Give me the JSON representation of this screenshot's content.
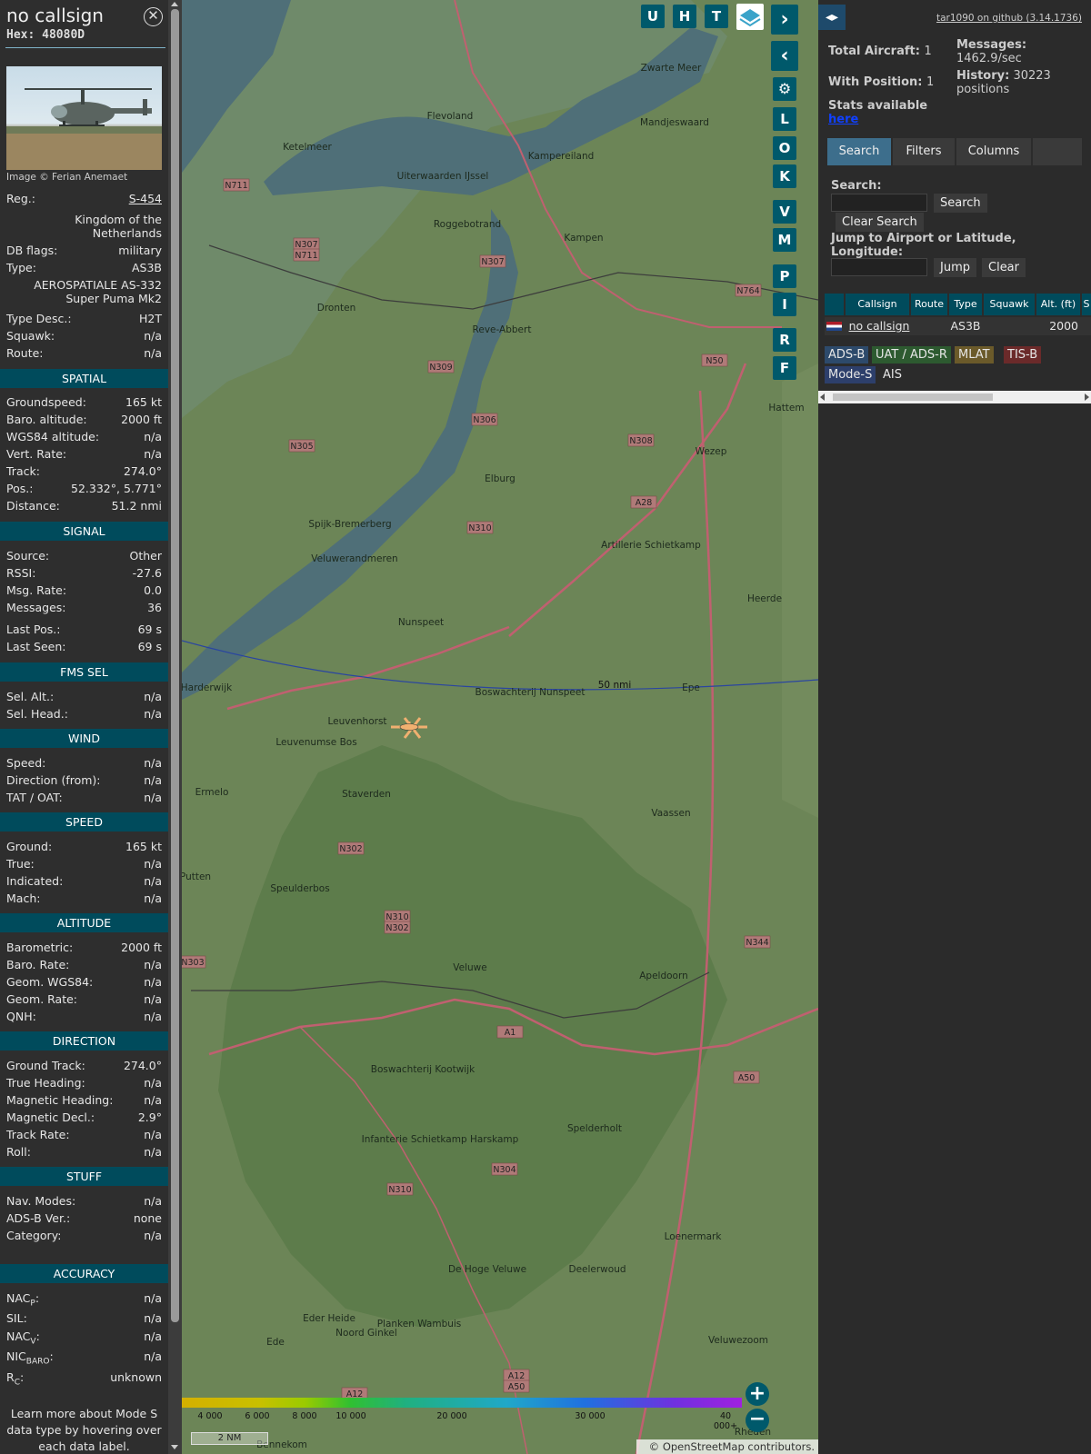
{
  "side": {
    "callsign": "no callsign",
    "hex": "Hex: 48080D",
    "credit": "Image © Ferian Anemaet",
    "reg_label": "Reg.:",
    "reg": "S-454",
    "country": "Kingdom of the Netherlands",
    "dbflags_label": "DB flags:",
    "dbflags": "military",
    "type_label": "Type:",
    "type": "AS3B",
    "type_full": "AEROSPATIALE AS-332 Super Puma Mk2",
    "typedesc_label": "Type Desc.:",
    "typedesc": "H2T",
    "squawk_label": "Squawk:",
    "squawk": "n/a",
    "route_label": "Route:",
    "route": "n/a",
    "sections": {
      "spatial": "SPATIAL",
      "signal": "SIGNAL",
      "fms": "FMS SEL",
      "wind": "WIND",
      "speed": "SPEED",
      "altitude": "ALTITUDE",
      "direction": "DIRECTION",
      "stuff": "STUFF",
      "accuracy": "ACCURACY"
    },
    "spatial": [
      [
        "Groundspeed:",
        "165 kt"
      ],
      [
        "Baro. altitude:",
        "2000 ft"
      ],
      [
        "WGS84 altitude:",
        "n/a"
      ],
      [
        "Vert. Rate:",
        "n/a"
      ],
      [
        "Track:",
        "274.0°"
      ],
      [
        "Pos.:",
        "52.332°, 5.771°"
      ],
      [
        "Distance:",
        "51.2 nmi"
      ]
    ],
    "signal": [
      [
        "Source:",
        "Other"
      ],
      [
        "RSSI:",
        "-27.6"
      ],
      [
        "Msg. Rate:",
        "0.0"
      ],
      [
        "Messages:",
        "36"
      ],
      [
        "Last Pos.:",
        "69 s"
      ],
      [
        "Last Seen:",
        "69 s"
      ]
    ],
    "fms": [
      [
        "Sel. Alt.:",
        "n/a"
      ],
      [
        "Sel. Head.:",
        "n/a"
      ]
    ],
    "wind": [
      [
        "Speed:",
        "n/a"
      ],
      [
        "Direction (from):",
        "n/a"
      ],
      [
        "TAT / OAT:",
        "n/a"
      ]
    ],
    "speed": [
      [
        "Ground:",
        "165 kt"
      ],
      [
        "True:",
        "n/a"
      ],
      [
        "Indicated:",
        "n/a"
      ],
      [
        "Mach:",
        "n/a"
      ]
    ],
    "altitude": [
      [
        "Barometric:",
        "2000 ft"
      ],
      [
        "Baro. Rate:",
        "n/a"
      ],
      [
        "Geom. WGS84:",
        "n/a"
      ],
      [
        "Geom. Rate:",
        "n/a"
      ],
      [
        "QNH:",
        "n/a"
      ]
    ],
    "direction": [
      [
        "Ground Track:",
        "274.0°"
      ],
      [
        "True Heading:",
        "n/a"
      ],
      [
        "Magnetic Heading:",
        "n/a"
      ],
      [
        "Magnetic Decl.:",
        "2.9°"
      ],
      [
        "Track Rate:",
        "n/a"
      ],
      [
        "Roll:",
        "n/a"
      ]
    ],
    "stuff": [
      [
        "Nav. Modes:",
        "n/a"
      ],
      [
        "ADS-B Ver.:",
        "none"
      ],
      [
        "Category:",
        "n/a"
      ]
    ],
    "acc": {
      "nacp": "NAC",
      "nacp_sub": "P",
      "nacp_v": "n/a",
      "sil": "SIL:",
      "sil_v": "n/a",
      "nacv": "NAC",
      "nacv_sub": "V",
      "nacv_v": "n/a",
      "nic": "NIC",
      "nic_sub": "BARO",
      "nic_v": "n/a",
      "rc": "R",
      "rc_sub": "C",
      "rc_v": "unknown"
    },
    "learn": "Learn more about Mode S data type by hovering over each data label."
  },
  "map": {
    "buttons_top": [
      "U",
      "H",
      "T"
    ],
    "buttons_side": [
      "L",
      "O",
      "K",
      "V",
      "M",
      "P",
      "I",
      "R",
      "F"
    ],
    "places": [
      [
        "Flevoland",
        495,
        131
      ],
      [
        "Ketelmeer",
        338,
        165
      ],
      [
        "Kampereiland",
        617,
        175
      ],
      [
        "Mandjeswaard",
        742,
        138
      ],
      [
        "Zwarte Meer",
        738,
        78
      ],
      [
        "Uiterwaarden IJssel",
        487,
        197
      ],
      [
        "Roggebotrand",
        514,
        250
      ],
      [
        "Kampen",
        642,
        265
      ],
      [
        "Dronten",
        370,
        342
      ],
      [
        "Reve-Abbert",
        552,
        366
      ],
      [
        "Hattem",
        865,
        452
      ],
      [
        "Wezep",
        782,
        500
      ],
      [
        "Elburg",
        550,
        530
      ],
      [
        "Spijk-Bremerberg",
        385,
        580
      ],
      [
        "Veluwerandmeren",
        390,
        618
      ],
      [
        "Artillerie Schietkamp",
        716,
        603
      ],
      [
        "Heerde",
        841,
        662
      ],
      [
        "Nunspeet",
        463,
        688
      ],
      [
        "Harderwijk",
        227,
        760
      ],
      [
        "Leuvenhorst",
        393,
        797
      ],
      [
        "Boswachterij Nunspeet",
        583,
        765
      ],
      [
        "Epe",
        760,
        760
      ],
      [
        "Leuvenumse Bos",
        348,
        820
      ],
      [
        "Ermelo",
        233,
        875
      ],
      [
        "Staverden",
        403,
        877
      ],
      [
        "Vaassen",
        738,
        898
      ],
      [
        "Putten",
        215,
        968
      ],
      [
        "Speulderbos",
        330,
        981
      ],
      [
        "Veluwe",
        517,
        1068
      ],
      [
        "Apeldoorn",
        730,
        1077
      ],
      [
        "Boswachterij Kootwijk",
        465,
        1180
      ],
      [
        "Infanterie Schietkamp Harskamp",
        484,
        1257
      ],
      [
        "Spelderholt",
        654,
        1245
      ],
      [
        "Loenermark",
        762,
        1364
      ],
      [
        "De Hoge Veluwe",
        536,
        1400
      ],
      [
        "Deelerwoud",
        657,
        1400
      ],
      [
        "Eder Heide",
        362,
        1454
      ],
      [
        "Noord Ginkel",
        403,
        1470
      ],
      [
        "Planken Wambuis",
        461,
        1460
      ],
      [
        "Veluwezoom",
        812,
        1478
      ],
      [
        "Ede",
        303,
        1480
      ],
      [
        "Bennekom",
        310,
        1593
      ],
      [
        "Rheden",
        828,
        1579
      ]
    ],
    "roads": [
      [
        "N711",
        260,
        205
      ],
      [
        "N307",
        337,
        270
      ],
      [
        "N711",
        337,
        282
      ],
      [
        "N307",
        542,
        289
      ],
      [
        "N764",
        823,
        321
      ],
      [
        "N309",
        485,
        405
      ],
      [
        "N50",
        786,
        398
      ],
      [
        "N306",
        533,
        463
      ],
      [
        "N308",
        705,
        486
      ],
      [
        "N305",
        332,
        492
      ],
      [
        "A28",
        708,
        554
      ],
      [
        "N310",
        528,
        582
      ],
      [
        "N302",
        386,
        935
      ],
      [
        "N310",
        437,
        1010
      ],
      [
        "N302",
        437,
        1022
      ],
      [
        "N344",
        833,
        1038
      ],
      [
        "N303",
        212,
        1060
      ],
      [
        "A1",
        561,
        1137
      ],
      [
        "A50",
        821,
        1187
      ],
      [
        "N310",
        440,
        1310
      ],
      [
        "N304",
        555,
        1288
      ],
      [
        "A12",
        568,
        1515
      ],
      [
        "A50",
        568,
        1527
      ],
      [
        "A12",
        390,
        1535
      ]
    ],
    "range_label": "50 nmi",
    "scale": "2 NM",
    "attribution": "© OpenStreetMap contributors.",
    "alt_labels": [
      "4 000",
      "6 000",
      "8 000",
      "10 000",
      "20 000",
      "30 000",
      "40 000+"
    ]
  },
  "panel": {
    "github": "tar1090 on github (3.14.1736)",
    "total_label": "Total Aircraft:",
    "total": "1",
    "msgs_label": "Messages:",
    "msgs": "1462.9/sec",
    "withpos_label": "With Position:",
    "withpos": "1",
    "history_label": "History:",
    "history": "30223 positions",
    "stats": "Stats available",
    "here": "here",
    "tabs": [
      "Search",
      "Filters",
      "Columns"
    ],
    "search_label": "Search:",
    "search_btn": "Search",
    "clear_search": "Clear Search",
    "jump_label": "Jump to Airport or Latitude, Longitude:",
    "jump_btn": "Jump",
    "clear_btn": "Clear",
    "cols": [
      "Callsign",
      "Route",
      "Type",
      "Squawk",
      "Alt. (ft)",
      "S"
    ],
    "row": {
      "callsign": "no callsign",
      "route": "",
      "type": "AS3B",
      "squawk": "",
      "alt": "2000"
    },
    "legend": [
      "ADS-B",
      "UAT / ADS-R",
      "MLAT",
      "TIS-B",
      "Mode-S",
      "AIS"
    ],
    "legend_colors": [
      "#2d4a6b",
      "#2d5a30",
      "#6b5a2a",
      "#6b2a2a",
      "#2d3f6b",
      "#2b2b2b"
    ]
  }
}
